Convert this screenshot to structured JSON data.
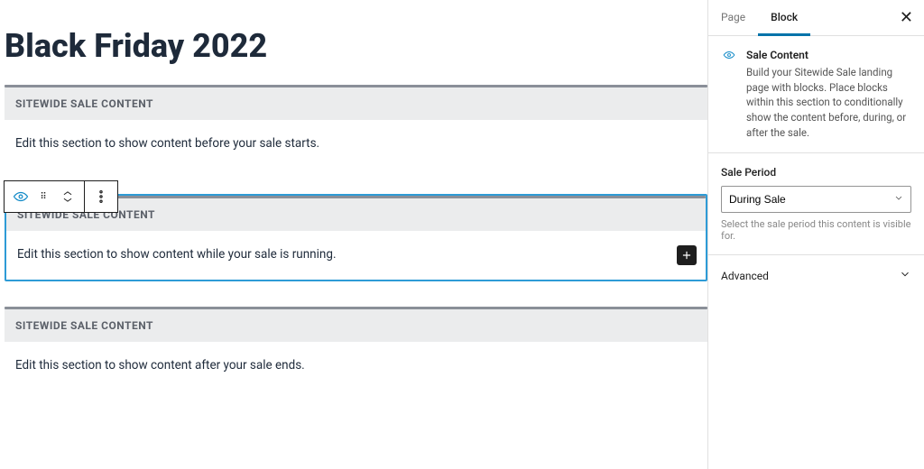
{
  "page_title": "Black Friday 2022",
  "toolbar_block_type": "Sale Content",
  "blocks": [
    {
      "heading": "SITEWIDE SALE CONTENT",
      "body": "Edit this section to show content before your sale starts."
    },
    {
      "heading": "SITEWIDE SALE CONTENT",
      "body": "Edit this section to show content while your sale is running."
    },
    {
      "heading": "SITEWIDE SALE CONTENT",
      "body": "Edit this section to show content after your sale ends."
    }
  ],
  "sidebar": {
    "tabs": {
      "page": "Page",
      "block": "Block"
    },
    "block_type": {
      "name": "Sale Content",
      "desc": "Build your Sitewide Sale landing page with blocks. Place blocks within this section to conditionally show the content before, during, or after the sale."
    },
    "sale_period": {
      "label": "Sale Period",
      "value": "During Sale",
      "hint": "Select the sale period this content is visible for."
    },
    "advanced": "Advanced"
  }
}
